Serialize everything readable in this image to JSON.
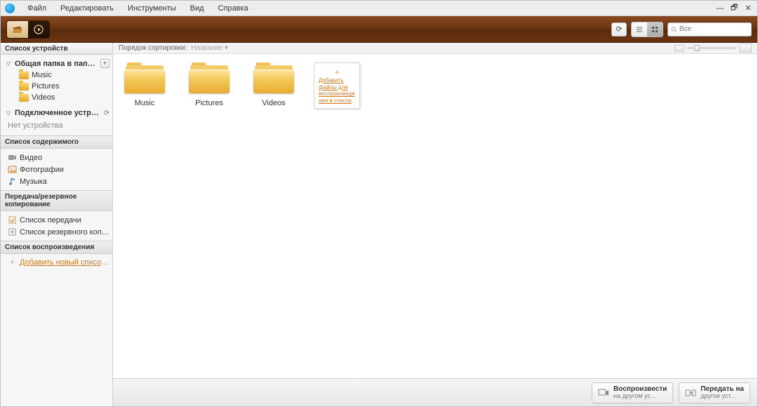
{
  "menu": {
    "items": [
      "Файл",
      "Редактировать",
      "Инструменты",
      "Вид",
      "Справка"
    ]
  },
  "window_controls": {
    "minimize": "—",
    "maximize": "🗗",
    "close": "✕"
  },
  "toolbar": {
    "refresh_tooltip": "⟳"
  },
  "search": {
    "placeholder": "Все"
  },
  "sidebar": {
    "title": "Список устройств",
    "shared": {
      "label": "Общая папка в папке \"Мой...",
      "children": [
        "Music",
        "Pictures",
        "Videos"
      ]
    },
    "connected": {
      "label": "Подключенное устройство...",
      "none_label": "Нет устройства"
    },
    "content_list": {
      "title": "Список содержимого",
      "items": [
        "Видео",
        "Фотографии",
        "Музыка"
      ]
    },
    "transfer": {
      "title": "Передача/резервное копирование",
      "items": [
        "Список передачи",
        "Список резервного копир..."
      ]
    },
    "playlists": {
      "title": "Список воспроизведения",
      "add_label": "Добавить новый список воспр..."
    }
  },
  "filter": {
    "label": "Порядок сортировки:",
    "value": "Название"
  },
  "folders": [
    "Music",
    "Pictures",
    "Videos"
  ],
  "add_card": {
    "text": "Добавить файлы для воспроизведения в список"
  },
  "footer": {
    "play": {
      "line1": "Воспроизвести",
      "line2": "на другом ус..."
    },
    "transfer": {
      "line1": "Передать на",
      "line2": "другое уст..."
    }
  }
}
